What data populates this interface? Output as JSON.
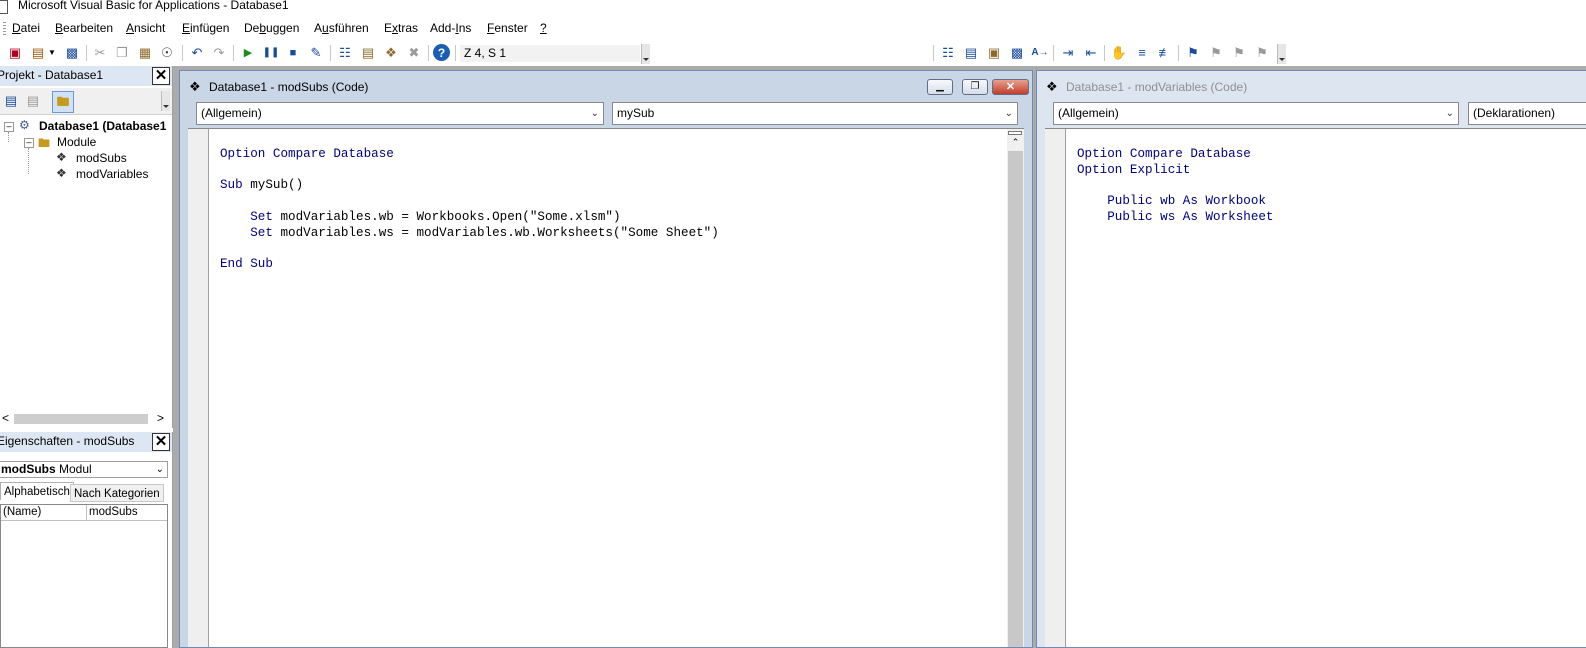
{
  "window": {
    "title": "Microsoft Visual Basic for Applications - Database1"
  },
  "menu": [
    {
      "pre": "",
      "ul": "D",
      "post": "atei"
    },
    {
      "pre": "",
      "ul": "B",
      "post": "earbeiten"
    },
    {
      "pre": "",
      "ul": "A",
      "post": "nsicht"
    },
    {
      "pre": "",
      "ul": "E",
      "post": "infügen"
    },
    {
      "pre": "De",
      "ul": "b",
      "post": "uggen"
    },
    {
      "pre": "A",
      "ul": "u",
      "post": "sführen"
    },
    {
      "pre": "E",
      "ul": "x",
      "post": "tras"
    },
    {
      "pre": "Add-",
      "ul": "I",
      "post": "ns"
    },
    {
      "pre": "",
      "ul": "F",
      "post": "enster"
    },
    {
      "pre": "",
      "ul": "?",
      "post": ""
    }
  ],
  "toolbar": {
    "position": "Z 4, S 1"
  },
  "project": {
    "title": "Projekt - Database1",
    "root": "Database1 (Database1",
    "folder": "Module",
    "modules": [
      "modSubs",
      "modVariables"
    ]
  },
  "properties": {
    "title": "Eigenschaften - modSubs",
    "object_name": "modSubs",
    "object_type": "Modul",
    "tabs": [
      "Alphabetisch",
      "Nach Kategorien"
    ],
    "rows": [
      {
        "name": "(Name)",
        "value": "modSubs"
      }
    ]
  },
  "code_windows": [
    {
      "title": "Database1 - modSubs (Code)",
      "object_combo": "(Allgemein)",
      "proc_combo": "mySub",
      "lines": [
        {
          "kw": "Option Compare Database",
          "rest": ""
        },
        {
          "kw": "",
          "rest": ""
        },
        {
          "kw": "Sub",
          "rest": " mySub()"
        },
        {
          "kw": "",
          "rest": ""
        },
        {
          "kw": "    Set",
          "rest": " modVariables.wb = Workbooks.Open(\"Some.xlsm\")"
        },
        {
          "kw": "    Set",
          "rest": " modVariables.ws = modVariables.wb.Worksheets(\"Some Sheet\")"
        },
        {
          "kw": "",
          "rest": ""
        },
        {
          "kw": "End Sub",
          "rest": ""
        }
      ]
    },
    {
      "title": "Database1 - modVariables (Code)",
      "object_combo": "(Allgemein)",
      "proc_combo": "(Deklarationen)",
      "lines": [
        {
          "kw": "Option Compare Database",
          "rest": ""
        },
        {
          "kw": "Option Explicit",
          "rest": ""
        },
        {
          "kw": "",
          "rest": ""
        },
        {
          "kw": "    Public wb As Workbook",
          "rest": ""
        },
        {
          "kw": "    Public ws As Worksheet",
          "rest": ""
        }
      ]
    }
  ],
  "colors": {
    "keyword": "#00007f",
    "active_caption": "#c9d6e6",
    "mdi_background": "#ababab"
  }
}
